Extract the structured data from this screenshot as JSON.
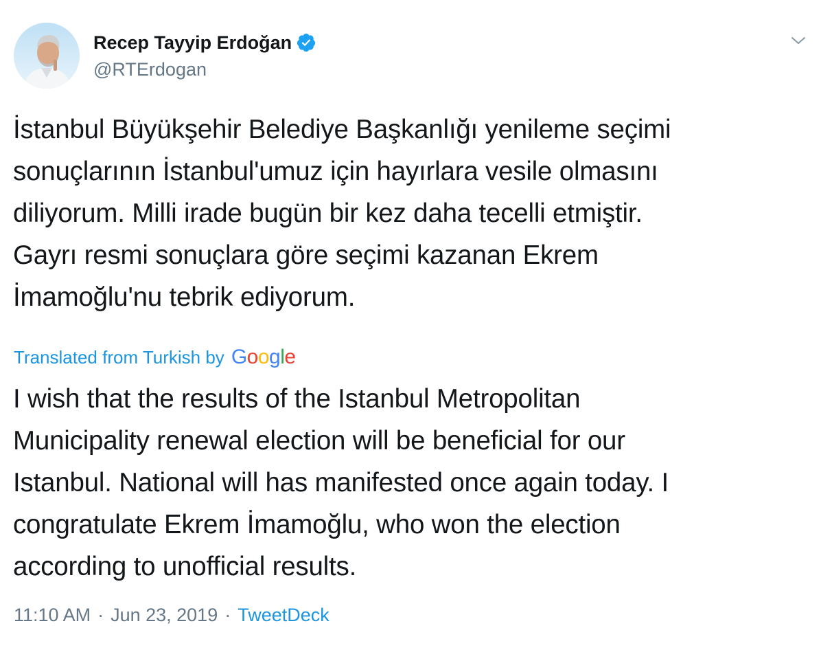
{
  "tweet": {
    "author": {
      "display_name": "Recep Tayyip Erdoğan",
      "handle": "@RTErdogan",
      "verified_icon": "verified-badge-icon",
      "avatar_icon": "profile-avatar"
    },
    "menu_icon": "chevron-down-icon",
    "original_text": "İstanbul Büyükşehir Belediye Başkanlığı yenileme seçimi\nsonuçlarının İstanbul'umuz için hayırlara vesile olmasını\ndiliyorum. Milli irade bugün bir kez daha tecelli etmiştir.\nGayrı resmi sonuçlara göre seçimi kazanan Ekrem\nİmamoğlu'nu tebrik ediyorum.",
    "translation": {
      "label": "Translated from Turkish by",
      "provider_letters": [
        "G",
        "o",
        "o",
        "g",
        "l",
        "e"
      ],
      "text": "I wish that the results of the Istanbul Metropolitan\nMunicipality renewal election will be beneficial for our\nIstanbul. National will has manifested once again today. I\ncongratulate Ekrem İmamoğlu, who won the election\naccording to unofficial results."
    },
    "meta": {
      "time": "11:10 AM",
      "separator": "·",
      "date": "Jun 23, 2019",
      "source": "TweetDeck"
    },
    "colors": {
      "link": "#1b95e0",
      "secondary_text": "#657786",
      "primary_text": "#14171a",
      "verified": "#1da1f2"
    }
  }
}
